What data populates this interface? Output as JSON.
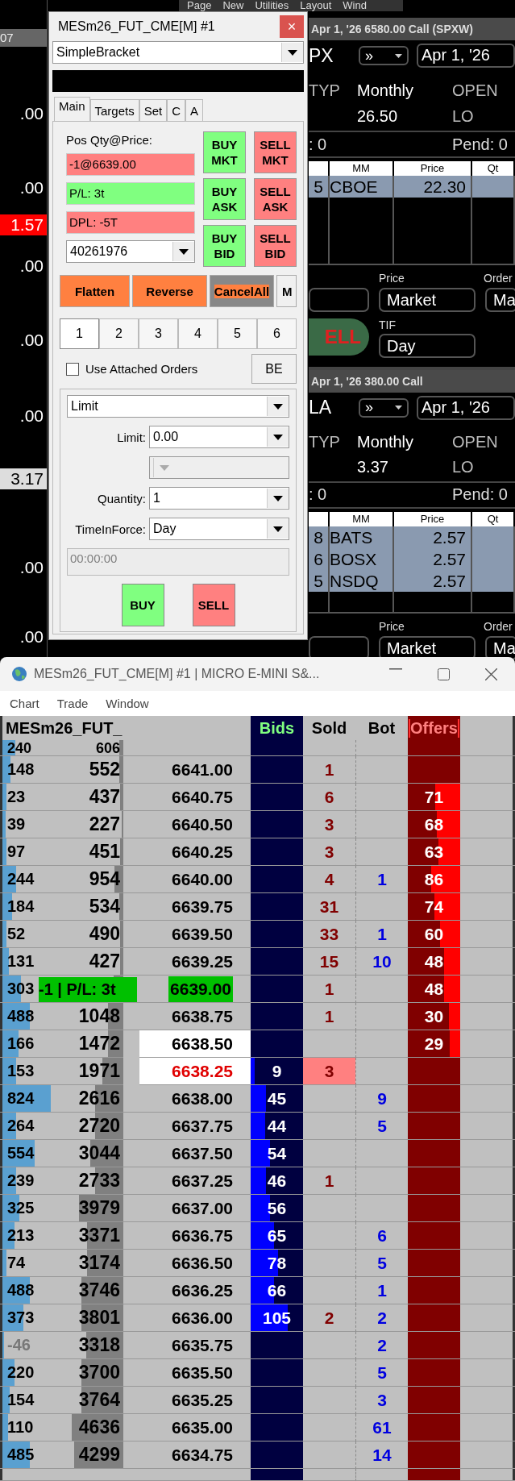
{
  "background": {
    "menu": [
      "Page",
      "New",
      "Utilities",
      "Layout",
      "Wind"
    ],
    "left_header": "07",
    "left_values": [
      {
        "text": ".00",
        "kind": "plain"
      },
      {
        "text": ".00",
        "kind": "plain"
      },
      {
        "text": "1.57",
        "kind": "alert"
      },
      {
        "text": ".00",
        "kind": "plain"
      },
      {
        "text": ".00",
        "kind": "plain"
      },
      {
        "text": ".00",
        "kind": "plain"
      },
      {
        "text": "3.17",
        "kind": "highlight"
      },
      {
        "text": ".00",
        "kind": "plain"
      },
      {
        "text": ".00",
        "kind": "plain"
      }
    ],
    "option_panels": [
      {
        "title": "Apr 1, '26 6580.00 Call (SPXW)",
        "symbol": "PX",
        "expiry_select": "»",
        "expiry": "Apr 1, '26",
        "type_label": "TYP",
        "type_value": "Monthly",
        "open_label": "OPEN",
        "last": "26.50",
        "lo": "LO",
        "position": ": 0",
        "pending": "Pend: 0",
        "columns": [
          "",
          "MM",
          "Price",
          "Qt"
        ],
        "rows": [
          {
            "cells": [
              "5",
              "CBOE",
              "22.30",
              ""
            ]
          }
        ],
        "price_label": "Price",
        "order_label": "Order",
        "price_type": "Market",
        "order_type": "Ma",
        "tif_label": "TIF",
        "sell": "ELL",
        "tif": "Day"
      },
      {
        "title": "Apr 1, '26 380.00 Call",
        "symbol": "LA",
        "expiry_select": "»",
        "expiry": "Apr 1, '26",
        "type_label": "TYP",
        "type_value": "Monthly",
        "open_label": "OPEN",
        "last": "3.37",
        "lo": "LO",
        "position": ": 0",
        "pending": "Pend: 0",
        "columns": [
          "",
          "MM",
          "Price",
          "Qt"
        ],
        "rows": [
          {
            "cells": [
              "8",
              "BATS",
              "2.57",
              ""
            ]
          },
          {
            "cells": [
              "6",
              "BOSX",
              "2.57",
              ""
            ]
          },
          {
            "cells": [
              "5",
              "NSDQ",
              "2.57",
              ""
            ]
          }
        ],
        "price_label": "Price",
        "order_label": "Order",
        "price_type": "Market",
        "order_type": "Ma"
      }
    ]
  },
  "order_window": {
    "title": "MESm26_FUT_CME[M] #1",
    "close": "×",
    "strategy": "SimpleBracket",
    "tabs": [
      {
        "label": "Main",
        "selected": true
      },
      {
        "label": "Targets",
        "selected": false
      },
      {
        "label": "Set",
        "selected": false
      },
      {
        "label": "C",
        "selected": false
      },
      {
        "label": "A",
        "selected": false
      }
    ],
    "pos_label": "Pos Qty@Price:",
    "fields": [
      {
        "text": "-1@6639.00",
        "kind": "loss"
      },
      {
        "text": "P/L: 3t",
        "kind": "profit"
      },
      {
        "text": "DPL: -5T",
        "kind": "loss"
      }
    ],
    "account": "40261976",
    "trade_buttons": [
      {
        "label": "BUY MKT",
        "kind": "buy"
      },
      {
        "label": "SELL MKT",
        "kind": "sell"
      },
      {
        "label": "BUY ASK",
        "kind": "buy"
      },
      {
        "label": "SELL ASK",
        "kind": "sell"
      },
      {
        "label": "BUY BID",
        "kind": "buy"
      },
      {
        "label": "SELL BID",
        "kind": "sell"
      }
    ],
    "action_buttons": [
      {
        "label": "Flatten",
        "kind": "primary"
      },
      {
        "label": "Reverse",
        "kind": "primary"
      },
      {
        "label": "CancelAll",
        "kind": "cancel"
      },
      {
        "label": "M",
        "kind": "plain"
      }
    ],
    "slots": [
      {
        "label": "1",
        "selected": true
      },
      {
        "label": "2",
        "selected": false
      },
      {
        "label": "3",
        "selected": false
      },
      {
        "label": "4",
        "selected": false
      },
      {
        "label": "5",
        "selected": false
      },
      {
        "label": "6",
        "selected": false
      }
    ],
    "attached": {
      "label": "Use Attached Orders",
      "checked": false
    },
    "be": "BE",
    "order_type": "Limit",
    "form_rows": [
      {
        "label": "Limit:",
        "value": "0.00",
        "disabled": false
      },
      {
        "disabled": true
      },
      {
        "label": "Quantity:",
        "value": "1",
        "disabled": false
      },
      {
        "label": "TimeInForce:",
        "value": "Day",
        "disabled": false
      }
    ],
    "time_field": {
      "value": "00:00:00",
      "disabled": true
    },
    "buy": "BUY",
    "sell": "SELL"
  },
  "ladder_window": {
    "title": "MESm26_FUT_CME[M] #1 | MICRO E-MINI S&...",
    "menu": [
      "Chart",
      "Trade",
      "Window"
    ],
    "symbol": "MESm26_FUT_",
    "columns": [
      "Bids",
      "Sold",
      "Bot",
      "Offers"
    ],
    "rows": [
      {
        "kind": "partial",
        "volume": {
          "text": "240",
          "level": 0.21,
          "muted": false
        },
        "total": {
          "text": "606",
          "level": 0.07
        },
        "sold_hit": false
      },
      {
        "kind": "normal",
        "volume": {
          "text": "148",
          "level": 0.13,
          "muted": false
        },
        "total": {
          "text": "552",
          "level": 0.07
        },
        "price": "6641.00",
        "sold": "1",
        "sold_hit": false
      },
      {
        "kind": "normal",
        "volume": {
          "text": "23",
          "level": 0.07,
          "muted": false
        },
        "total": {
          "text": "437",
          "level": 0.05
        },
        "price": "6640.75",
        "sold": "6",
        "sold_hit": false,
        "offer": {
          "text": "71",
          "level": 0.47
        }
      },
      {
        "kind": "normal",
        "volume": {
          "text": "39",
          "level": 0.05,
          "muted": false
        },
        "total": {
          "text": "227",
          "level": 0.03
        },
        "price": "6640.50",
        "sold": "3",
        "sold_hit": false,
        "offer": {
          "text": "68",
          "level": 0.44
        }
      },
      {
        "kind": "normal",
        "volume": {
          "text": "97",
          "level": 0.07,
          "muted": false
        },
        "total": {
          "text": "451",
          "level": 0.05
        },
        "price": "6640.25",
        "sold": "3",
        "sold_hit": false,
        "offer": {
          "text": "63",
          "level": 0.41
        }
      },
      {
        "kind": "normal",
        "volume": {
          "text": "244",
          "level": 0.23,
          "muted": false
        },
        "total": {
          "text": "954",
          "level": 0.15
        },
        "price": "6640.00",
        "sold": "4",
        "sold_hit": false,
        "bot": "1",
        "offer": {
          "text": "86",
          "level": 0.56
        }
      },
      {
        "kind": "normal",
        "volume": {
          "text": "184",
          "level": 0.16,
          "muted": false
        },
        "total": {
          "text": "534",
          "level": 0.07
        },
        "price": "6639.75",
        "sold": "31",
        "sold_hit": false,
        "offer": {
          "text": "74",
          "level": 0.49
        }
      },
      {
        "kind": "normal",
        "volume": {
          "text": "52",
          "level": 0.06,
          "muted": false
        },
        "total": {
          "text": "490",
          "level": 0.06
        },
        "price": "6639.50",
        "sold": "33",
        "sold_hit": false,
        "bot": "1",
        "offer": {
          "text": "60",
          "level": 0.39
        }
      },
      {
        "kind": "normal",
        "volume": {
          "text": "131",
          "level": 0.1,
          "muted": false
        },
        "total": {
          "text": "427",
          "level": 0.05
        },
        "price": "6639.25",
        "sold": "15",
        "sold_hit": false,
        "bot": "10",
        "offer": {
          "text": "48",
          "level": 0.31
        }
      },
      {
        "kind": "position",
        "volume": {
          "text": "303",
          "level": 0.3,
          "muted": false
        },
        "total": {
          "level": 0.16
        },
        "position_label": "-1 | P/L: 3t",
        "price": "6639.00",
        "sold": "1",
        "sold_hit": false,
        "offer": {
          "text": "48",
          "level": 0.31
        }
      },
      {
        "kind": "normal",
        "volume": {
          "text": "488",
          "level": 0.45,
          "muted": false
        },
        "total": {
          "text": "1048",
          "level": 0.25
        },
        "price": "6638.75",
        "sold": "1",
        "sold_hit": false,
        "offer": {
          "text": "30",
          "level": 0.21
        }
      },
      {
        "kind": "ask",
        "volume": {
          "text": "166",
          "level": 0.26,
          "muted": false
        },
        "total": {
          "text": "1472",
          "level": 0.25
        },
        "price": "6638.50",
        "sold_hit": false,
        "offer": {
          "text": "29",
          "level": 0.2
        }
      },
      {
        "kind": "last",
        "volume": {
          "text": "153",
          "level": 0.23,
          "muted": false
        },
        "total": {
          "text": "1971",
          "level": 0.35
        },
        "price": "6638.25",
        "bid": {
          "text": "9",
          "level": 0.08
        },
        "sold": "3",
        "sold_hit": true
      },
      {
        "kind": "normal",
        "volume": {
          "text": "824",
          "level": 0.8,
          "muted": false
        },
        "total": {
          "text": "2616",
          "level": 0.47
        },
        "price": "6638.00",
        "bid": {
          "text": "45",
          "level": 0.29
        },
        "sold_hit": false,
        "bot": "9"
      },
      {
        "kind": "normal",
        "volume": {
          "text": "264",
          "level": 0.23,
          "muted": false
        },
        "total": {
          "text": "2720",
          "level": 0.47
        },
        "price": "6637.75",
        "bid": {
          "text": "44",
          "level": 0.28
        },
        "sold_hit": false,
        "bot": "5"
      },
      {
        "kind": "normal",
        "volume": {
          "text": "554",
          "level": 0.53,
          "muted": false
        },
        "total": {
          "text": "3044",
          "level": 0.55
        },
        "price": "6637.50",
        "bid": {
          "text": "54",
          "level": 0.37
        },
        "sold_hit": false
      },
      {
        "kind": "normal",
        "volume": {
          "text": "239",
          "level": 0.22,
          "muted": false
        },
        "total": {
          "text": "2733",
          "level": 0.47
        },
        "price": "6637.25",
        "bid": {
          "text": "46",
          "level": 0.29
        },
        "sold": "1",
        "sold_hit": false
      },
      {
        "kind": "normal",
        "volume": {
          "text": "325",
          "level": 0.28,
          "muted": false
        },
        "total": {
          "text": "3979",
          "level": 0.74
        },
        "price": "6637.00",
        "bid": {
          "text": "56",
          "level": 0.37
        },
        "sold_hit": false
      },
      {
        "kind": "normal",
        "volume": {
          "text": "213",
          "level": 0.2,
          "muted": false
        },
        "total": {
          "text": "3371",
          "level": 0.6
        },
        "price": "6636.75",
        "bid": {
          "text": "65",
          "level": 0.45
        },
        "sold_hit": false,
        "bot": "6"
      },
      {
        "kind": "normal",
        "volume": {
          "text": "74",
          "level": 0.07,
          "muted": false
        },
        "total": {
          "text": "3174",
          "level": 0.6
        },
        "price": "6636.50",
        "bid": {
          "text": "78",
          "level": 0.53
        },
        "sold_hit": false,
        "bot": "5"
      },
      {
        "kind": "normal",
        "volume": {
          "text": "488",
          "level": 0.45,
          "muted": false
        },
        "total": {
          "text": "3746",
          "level": 0.69
        },
        "price": "6636.25",
        "bid": {
          "text": "66",
          "level": 0.45
        },
        "sold_hit": false,
        "bot": "1"
      },
      {
        "kind": "normal",
        "volume": {
          "text": "373",
          "level": 0.35,
          "muted": false
        },
        "total": {
          "text": "3801",
          "level": 0.7
        },
        "price": "6636.00",
        "bid": {
          "text": "105",
          "level": 0.7
        },
        "sold": "2",
        "sold_hit": false,
        "bot": "2"
      },
      {
        "kind": "normal",
        "volume": {
          "text": "-46",
          "level": 0.02,
          "muted": true
        },
        "total": {
          "text": "3318",
          "level": 0.62
        },
        "price": "6635.75",
        "sold_hit": false,
        "bot": "2"
      },
      {
        "kind": "normal",
        "volume": {
          "text": "220",
          "level": 0.2,
          "muted": false
        },
        "total": {
          "text": "3700",
          "level": 0.69
        },
        "price": "6635.50",
        "sold_hit": false,
        "bot": "5"
      },
      {
        "kind": "normal",
        "volume": {
          "text": "154",
          "level": 0.12,
          "muted": false
        },
        "total": {
          "text": "3764",
          "level": 0.69
        },
        "price": "6635.25",
        "sold_hit": false,
        "bot": "3"
      },
      {
        "kind": "normal",
        "volume": {
          "text": "110",
          "level": 0.09,
          "muted": false
        },
        "total": {
          "text": "4636",
          "level": 0.85
        },
        "price": "6635.00",
        "sold_hit": false,
        "bot": "61"
      },
      {
        "kind": "normal",
        "volume": {
          "text": "485",
          "level": 0.45,
          "muted": false
        },
        "total": {
          "text": "4299",
          "level": 0.81
        },
        "price": "6634.75",
        "sold_hit": false,
        "bot": "14"
      }
    ]
  }
}
